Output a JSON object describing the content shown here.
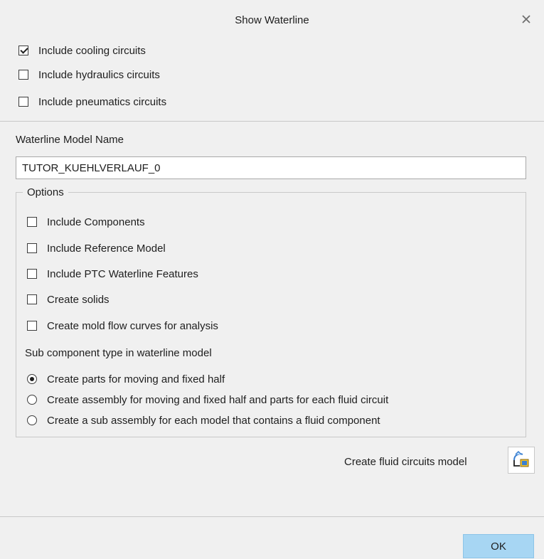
{
  "dialog": {
    "title": "Show Waterline",
    "close_icon": "close-icon"
  },
  "circuits": [
    {
      "label": "Include cooling circuits",
      "checked": true
    },
    {
      "label": "Include hydraulics circuits",
      "checked": false
    },
    {
      "label": "Include pneumatics circuits",
      "checked": false
    }
  ],
  "model_name": {
    "label": "Waterline Model Name",
    "value": "TUTOR_KUEHLVERLAUF_0"
  },
  "options": {
    "legend": "Options",
    "checkboxes": [
      {
        "label": "Include Components",
        "checked": false
      },
      {
        "label": "Include Reference Model",
        "checked": false
      },
      {
        "label": "Include PTC Waterline Features",
        "checked": false
      },
      {
        "label": "Create solids",
        "checked": false
      },
      {
        "label": "Create mold flow curves for analysis",
        "checked": false
      }
    ],
    "subcomponent_label": "Sub component type in waterline model",
    "radios": [
      {
        "label": "Create parts for moving and fixed half",
        "selected": true
      },
      {
        "label": "Create assembly for moving and fixed half and parts for each fluid circuit",
        "selected": false
      },
      {
        "label": "Create a sub assembly for each model that contains a fluid component",
        "selected": false
      }
    ]
  },
  "fluid_model": {
    "label": "Create fluid circuits model",
    "icon": "fluid-circuits-model-icon"
  },
  "footer": {
    "ok_label": "OK"
  },
  "colors": {
    "background": "#f0f0f0",
    "ok_button": "#a7d6f3",
    "border": "#c8c8c8"
  }
}
